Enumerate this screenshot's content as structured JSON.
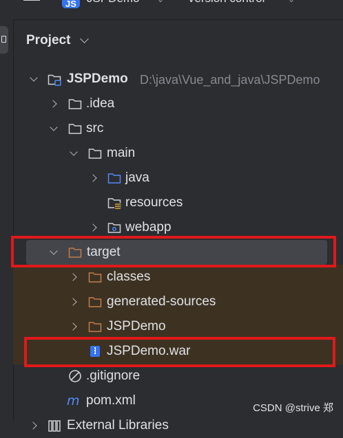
{
  "topbar": {
    "project_badge": "JS",
    "project_name": "JSPDemo",
    "version_control": "Version control"
  },
  "panel": {
    "title": "Project"
  },
  "tree": {
    "root_name": "JSPDemo",
    "root_path": "D:\\java\\Vue_and_java\\JSPDemo",
    "idea": ".idea",
    "src": "src",
    "main": "main",
    "java": "java",
    "resources": "resources",
    "webapp": "webapp",
    "target": "target",
    "classes": "classes",
    "generated_sources": "generated-sources",
    "target_jspdemo": "JSPDemo",
    "war": "JSPDemo.war",
    "gitignore": ".gitignore",
    "pom": "pom.xml",
    "external_libraries": "External Libraries"
  },
  "colors": {
    "highlight": "#e0191b",
    "folder": "#ced0d6",
    "source_folder": "#548af7",
    "excluded_folder": "#c27d4e",
    "selection": "#43454a",
    "excluded_band": "#3d3222"
  },
  "watermark": "CSDN @strive 郑"
}
